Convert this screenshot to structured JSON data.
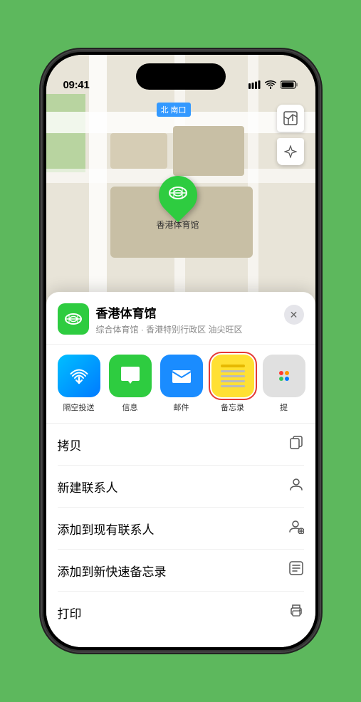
{
  "status": {
    "time": "09:41",
    "signal": "▌▌▌",
    "wifi": "wifi",
    "battery": "battery"
  },
  "map": {
    "label_text": "南口",
    "label_prefix": "北",
    "marker_label": "香港体育馆"
  },
  "controls": {
    "map_type_icon": "🗺",
    "location_icon": "➤"
  },
  "place": {
    "name": "香港体育馆",
    "description": "综合体育馆 · 香港特别行政区 油尖旺区",
    "close_icon": "✕"
  },
  "share_items": [
    {
      "id": "airdrop",
      "label": "隔空投送",
      "type": "airdrop"
    },
    {
      "id": "messages",
      "label": "信息",
      "type": "messages"
    },
    {
      "id": "mail",
      "label": "邮件",
      "type": "mail"
    },
    {
      "id": "notes",
      "label": "备忘录",
      "type": "notes"
    },
    {
      "id": "more",
      "label": "提",
      "type": "more"
    }
  ],
  "actions": [
    {
      "id": "copy",
      "label": "拷贝",
      "icon": "📋"
    },
    {
      "id": "new-contact",
      "label": "新建联系人",
      "icon": "👤"
    },
    {
      "id": "add-contact",
      "label": "添加到现有联系人",
      "icon": "👤+"
    },
    {
      "id": "quick-note",
      "label": "添加到新快速备忘录",
      "icon": "📝"
    },
    {
      "id": "print",
      "label": "打印",
      "icon": "🖨"
    }
  ]
}
